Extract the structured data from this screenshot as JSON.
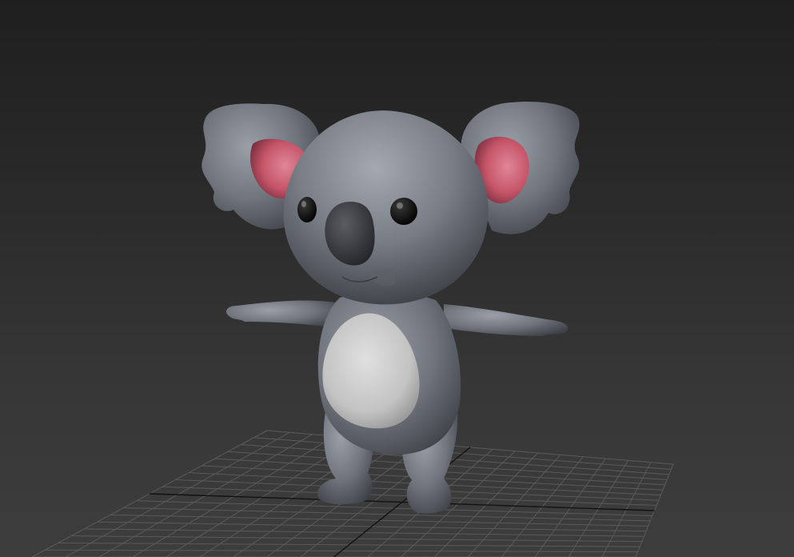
{
  "viewport": {
    "background_top": "#1f1f1f",
    "background_bottom": "#3d3d3d",
    "grid_line_color": "#5a5a5a",
    "grid_axis_color": "#111111"
  },
  "model": {
    "body_color": "#717680",
    "belly_color": "#cfcfcf",
    "inner_ear_color": "#cf5d72",
    "nose_color": "#3b3c40",
    "eye_color": "#141414"
  }
}
